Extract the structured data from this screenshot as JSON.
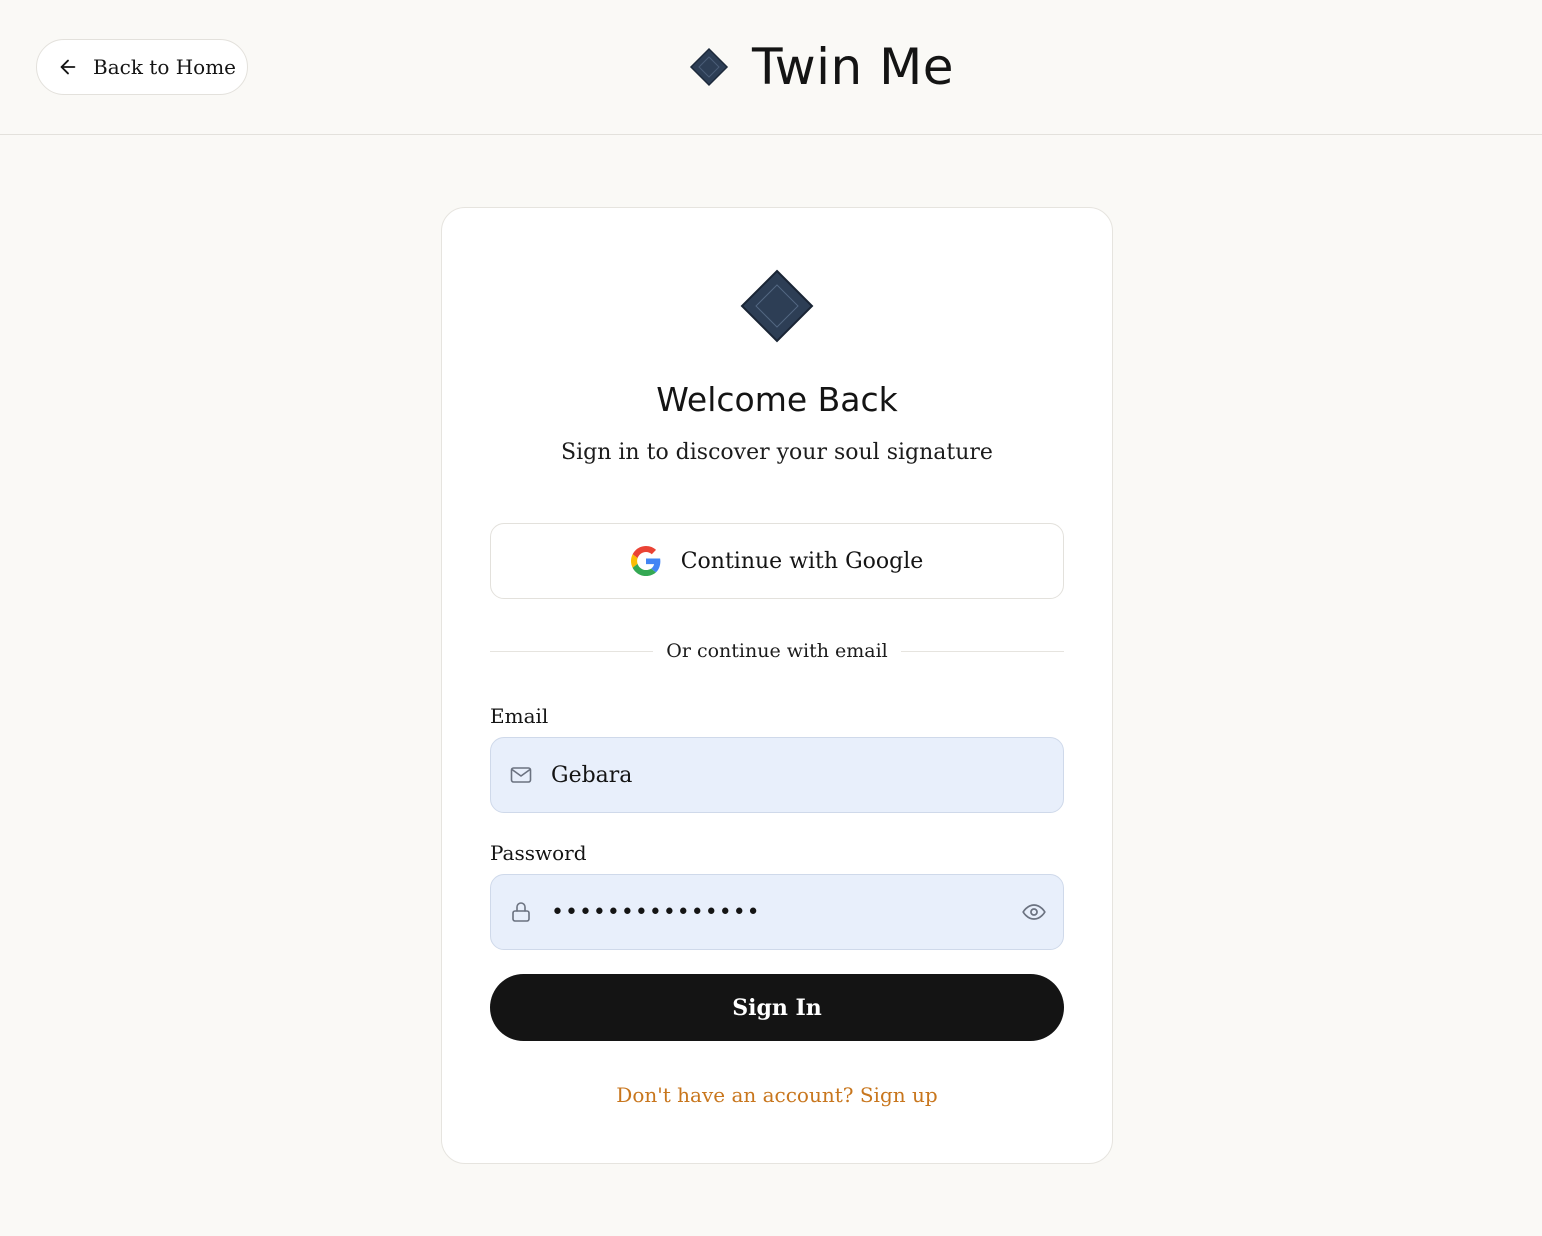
{
  "header": {
    "back_label": "Back to Home",
    "brand_title": "Twin Me"
  },
  "card": {
    "title": "Welcome Back",
    "subtitle": "Sign in to discover your soul signature",
    "google_label": "Continue with Google",
    "divider_text": "Or continue with email",
    "email": {
      "label": "Email",
      "value": "Gebara"
    },
    "password": {
      "label": "Password",
      "masked_value": "•••••••••••••••"
    },
    "signin_label": "Sign In",
    "signup_text": "Don't have an account? Sign up"
  },
  "colors": {
    "background": "#faf9f6",
    "card": "#ffffff",
    "brand_diamond": "#2d3e55",
    "input_fill": "#e8effb",
    "primary_button": "#141414",
    "link": "#c8761d"
  },
  "icons": {
    "back": "arrow-left-icon",
    "brand": "diamond-logo-icon",
    "google": "google-g-icon",
    "email": "mail-icon",
    "password": "lock-icon",
    "toggle": "eye-icon"
  }
}
